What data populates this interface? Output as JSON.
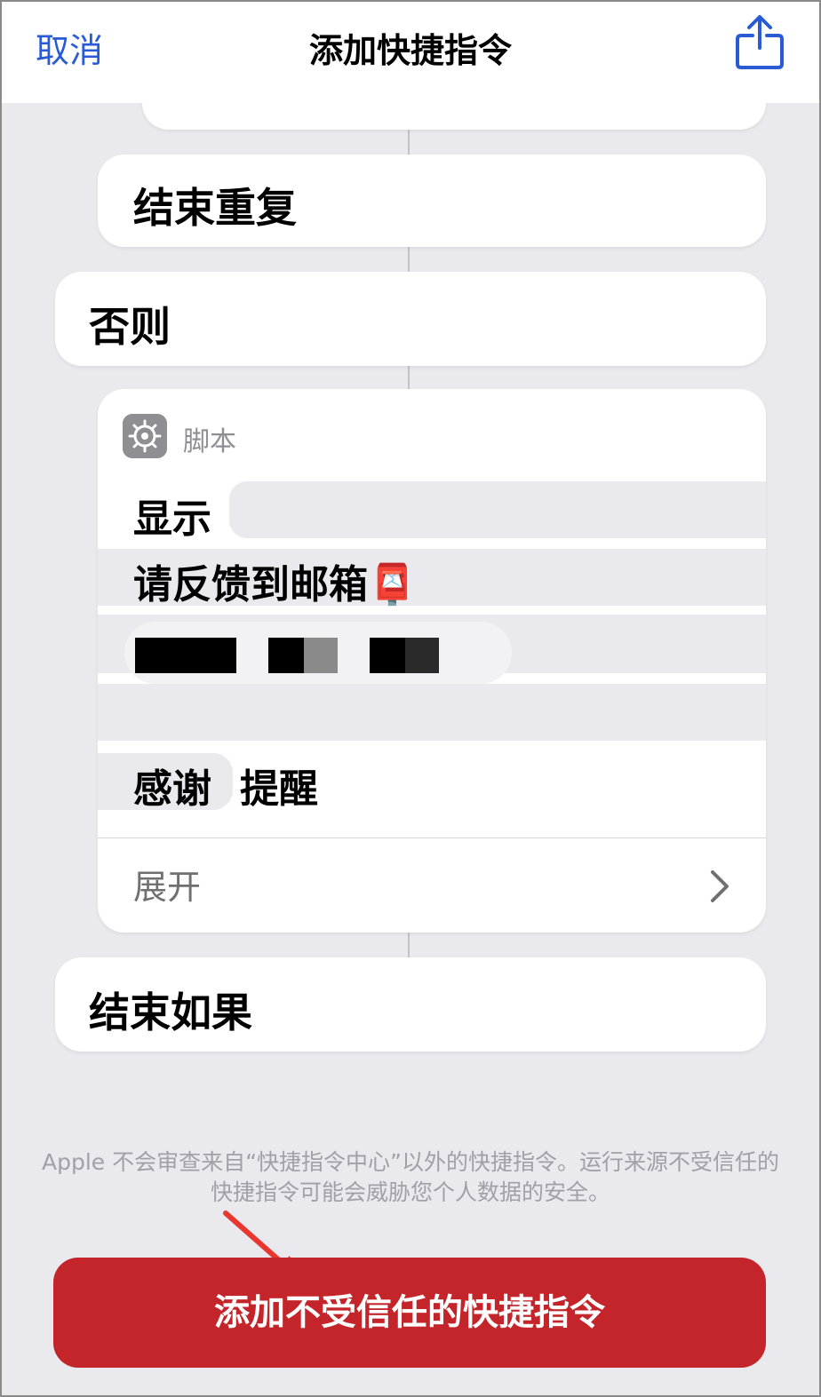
{
  "nav": {
    "cancel_label": "取消",
    "title": "添加快捷指令",
    "share_icon": "share-icon"
  },
  "actions": {
    "end_repeat": "结束重复",
    "otherwise": "否则",
    "script": {
      "app_icon": "gear-icon",
      "app_label": "脚本",
      "show_label": "显示",
      "line_feedback": "请反馈到邮箱",
      "mailbox_emoji": "📮",
      "thanks_label": "感谢",
      "reminder_label": "提醒",
      "expand_label": "展开",
      "chevron_icon": "chevron-right-icon"
    },
    "end_if": "结束如果"
  },
  "disclaimer": "Apple 不会审查来自“快捷指令中心”以外的快捷指令。运行来源不受信任的快捷指令可能会威胁您个人数据的安全。",
  "add_button_label": "添加不受信任的快捷指令",
  "colors": {
    "accent_blue": "#2a5bd6",
    "danger_red": "#c4252a",
    "background": "#e9e9ee",
    "annotation_arrow": "#e8372f"
  }
}
